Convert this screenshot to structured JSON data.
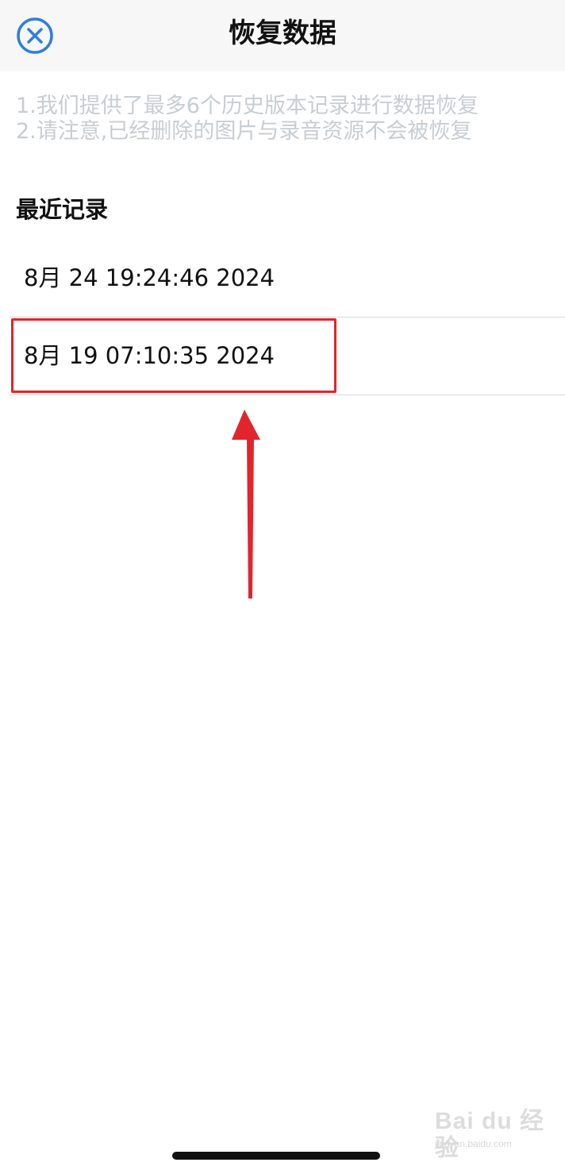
{
  "header": {
    "title": "恢复数据",
    "close_icon": "close-circle-icon",
    "accent_color": "#2f7de1"
  },
  "notice": {
    "line1": "1.我们提供了最多6个历史版本记录进行数据恢复",
    "line2": "2.请注意,已经删除的图片与录音资源不会被恢复"
  },
  "section": {
    "title": "最近记录"
  },
  "records": [
    {
      "label": "8月 24 19:24:46 2024"
    },
    {
      "label": "8月 19 07:10:35 2024",
      "highlighted": true
    }
  ],
  "annotation": {
    "highlight_color": "#e2252c",
    "arrow_icon": "red-arrow-up"
  },
  "watermark": {
    "logo": "Bai du 经验",
    "url": "jingyan.baidu.com"
  }
}
